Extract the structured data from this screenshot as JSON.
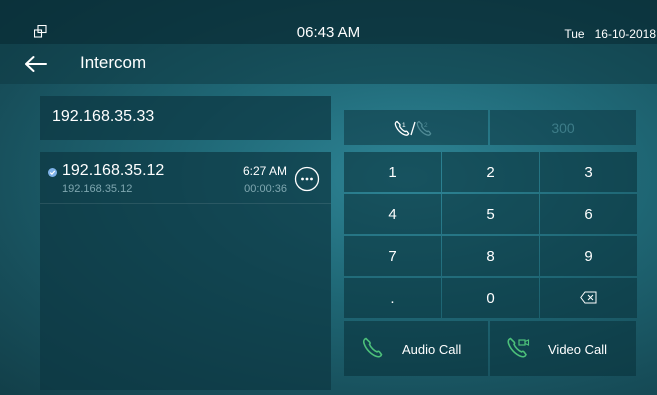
{
  "status_bar": {
    "time": "06:43 AM",
    "date": "Tue   16-10-2018"
  },
  "header": {
    "title": "Intercom"
  },
  "address": {
    "value": "192.168.35.33"
  },
  "history": [
    {
      "name": "192.168.35.12",
      "ip": "192.168.35.12",
      "time": "6:27 AM",
      "duration": "00:00:36"
    }
  ],
  "dialer": {
    "number_display": "300",
    "keys": [
      "1",
      "2",
      "3",
      "4",
      "5",
      "6",
      "7",
      "8",
      "9",
      ".",
      "0"
    ],
    "audio_call_label": "Audio Call",
    "video_call_label": "Video Call"
  },
  "colors": {
    "accent_teal": "#1f6775",
    "muted_text": "#7fa7b0",
    "call_icon_green": "#4cc07a"
  }
}
